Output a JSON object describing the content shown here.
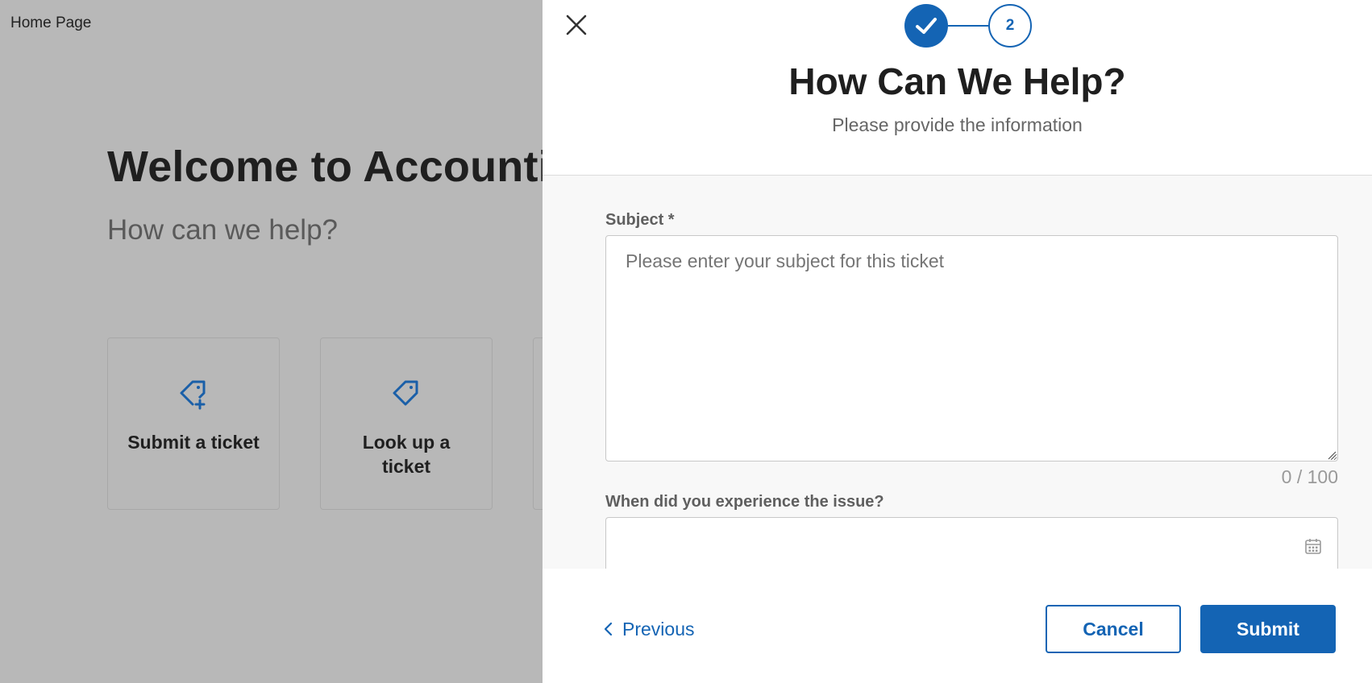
{
  "background_page": {
    "home_link": "Home Page",
    "welcome_title": "Welcome to Accountin",
    "welcome_subtitle": "How can we help?",
    "cards": [
      {
        "label": "Submit a ticket",
        "icon": "tag-plus-icon"
      },
      {
        "label": "Look up a ticket",
        "icon": "tag-icon"
      }
    ]
  },
  "dialog": {
    "stepper": {
      "step1_state": "completed",
      "step2_label": "2"
    },
    "title": "How Can We Help?",
    "subtitle": "Please provide the information",
    "subject": {
      "label": "Subject *",
      "placeholder": "Please enter your subject for this ticket",
      "value": "",
      "counter": "0 / 100"
    },
    "issue_date": {
      "label": "When did you experience the issue?",
      "value": "",
      "icon": "calendar-icon"
    },
    "footer": {
      "previous_label": "Previous",
      "cancel_label": "Cancel",
      "submit_label": "Submit"
    }
  },
  "colors": {
    "accent": "#1464b4",
    "overlay": "#b8b8b8",
    "form_background": "#f8f8f8"
  }
}
